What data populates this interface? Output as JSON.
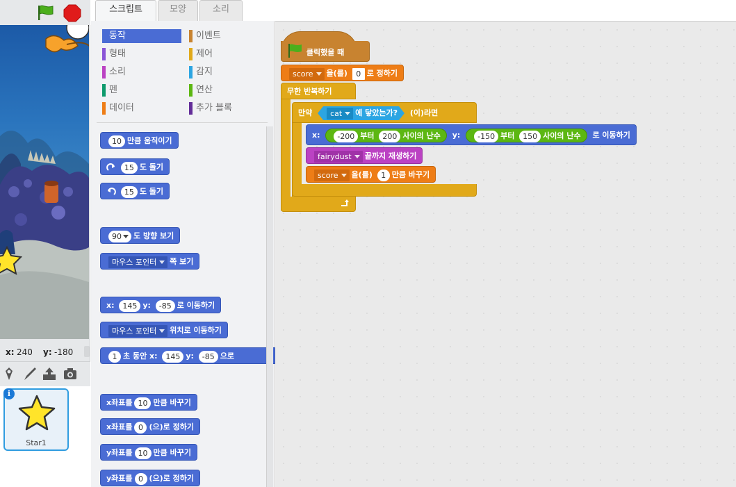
{
  "tabs": [
    "스크립트",
    "모양",
    "소리"
  ],
  "categories_left": [
    {
      "label": "동작",
      "color": "#4a6cd4",
      "active": true
    },
    {
      "label": "형태",
      "color": "#8a55d7"
    },
    {
      "label": "소리",
      "color": "#bb42c3"
    },
    {
      "label": "펜",
      "color": "#0e9a6c"
    },
    {
      "label": "데이터",
      "color": "#ee7d16"
    }
  ],
  "categories_right": [
    {
      "label": "이벤트",
      "color": "#c88330"
    },
    {
      "label": "제어",
      "color": "#e1a91a"
    },
    {
      "label": "감지",
      "color": "#2ca5e2"
    },
    {
      "label": "연산",
      "color": "#5cb712"
    },
    {
      "label": "추가 블록",
      "color": "#632d99"
    }
  ],
  "palette": {
    "move": {
      "value": "10",
      "text": "만큼 움직이기"
    },
    "turn_right": {
      "value": "15",
      "text": "도 돌기"
    },
    "turn_left": {
      "value": "15",
      "text": "도 돌기"
    },
    "point_dir": {
      "value": "90",
      "text": "도 방향 보기"
    },
    "point_towards": {
      "option": "마우스 포인터",
      "text": "쪽 보기"
    },
    "goto_xy": {
      "x_label": "x:",
      "x": "145",
      "y_label": "y:",
      "y": "-85",
      "text": "로 이동하기"
    },
    "goto_target": {
      "option": "마우스 포인터",
      "text": "위치로 이동하기"
    },
    "glide": {
      "secs": "1",
      "text1": "초 동안 x:",
      "x": "145",
      "y_label": "y:",
      "y": "-85",
      "text2": "으로"
    },
    "change_x": {
      "label": "x좌표를",
      "value": "10",
      "text": "만큼 바꾸기"
    },
    "set_x": {
      "label": "x좌표를",
      "value": "0",
      "text": "(으)로 정하기"
    },
    "change_y": {
      "label": "y좌표를",
      "value": "10",
      "text": "만큼 바꾸기"
    },
    "set_y": {
      "label": "y좌표를",
      "value": "0",
      "text": "(으)로 정하기"
    }
  },
  "script": {
    "hat": "클릭했을 때",
    "set_var": {
      "var": "score",
      "mid": "을(를)",
      "value": "0",
      "end": "로 정하기"
    },
    "forever": "무한 반복하기",
    "if": {
      "pre": "만약",
      "target": "cat",
      "touch": "에 닿았는가?",
      "post": "(이)라면"
    },
    "goto_random": {
      "x_label": "x:",
      "x_from": "-200",
      "from_mid": "부터",
      "x_to": "200",
      "rand_end": "사이의 난수",
      "y_label": "y:",
      "y_from": "-150",
      "y_to": "150",
      "end": "로 이동하기"
    },
    "play_sound": {
      "sound": "fairydust",
      "text": "끝까지 재생하기"
    },
    "change_var": {
      "var": "score",
      "mid": "을(를)",
      "value": "1",
      "end": "만큼 바꾸기"
    }
  },
  "stage": {
    "x_label": "x:",
    "x_value": "240",
    "y_label": "y:",
    "y_value": "-180"
  },
  "sprite": {
    "name": "Star1",
    "info": "i"
  }
}
